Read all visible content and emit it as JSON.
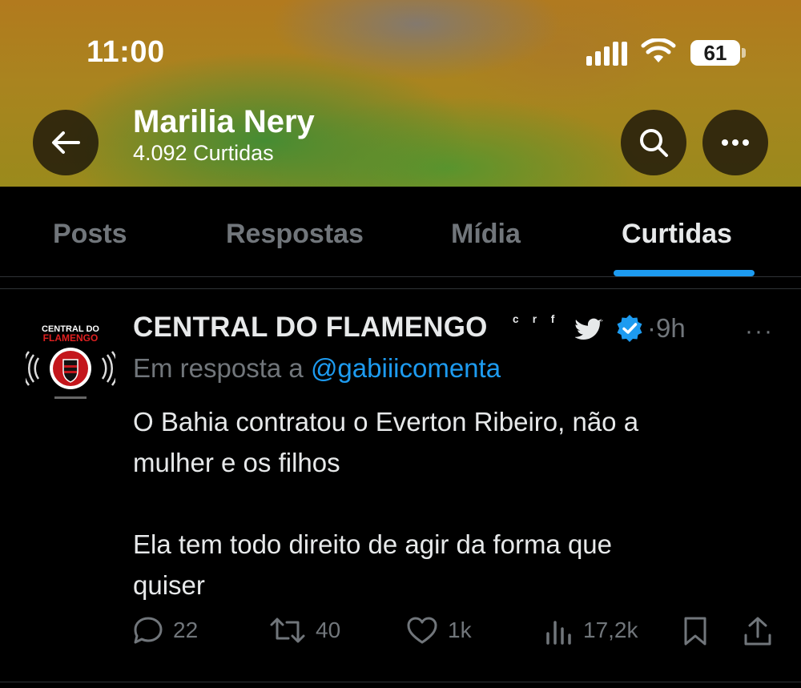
{
  "status_bar": {
    "time": "11:00",
    "battery": "61"
  },
  "profile": {
    "name": "Marilia Nery",
    "subtitle": "4.092 Curtidas"
  },
  "tabs": [
    {
      "label": "Posts",
      "active": false
    },
    {
      "label": "Respostas",
      "active": false
    },
    {
      "label": "Mídia",
      "active": false
    },
    {
      "label": "Curtidas",
      "active": true
    }
  ],
  "tweet": {
    "avatar_text": {
      "line1": "CENTRAL DO",
      "line2": "FLAMENGO"
    },
    "author": "CENTRAL DO FLAMENGO",
    "name_suffix": "ᶜ ʳ ᶠ",
    "time": "·9h",
    "more": "···",
    "reply_prefix": "Em resposta a ",
    "reply_handle": "@gabiiicomenta",
    "text": "O Bahia contratou o Everton Ribeiro, não a\nmulher e os filhos\n\nEla tem todo direito de agir da forma que\nquiser",
    "stats": {
      "replies": "22",
      "reposts": "40",
      "likes": "1k",
      "views": "17,2k"
    }
  },
  "colors": {
    "accent": "#1d9bf0",
    "muted": "#71767b",
    "text": "#e7e9ea",
    "background": "#000000"
  },
  "icons": [
    "back-arrow-icon",
    "search-icon",
    "more-icon",
    "twitter-bird-icon",
    "verified-badge-icon",
    "reply-icon",
    "repost-icon",
    "like-icon",
    "views-icon",
    "bookmark-icon",
    "share-icon"
  ]
}
